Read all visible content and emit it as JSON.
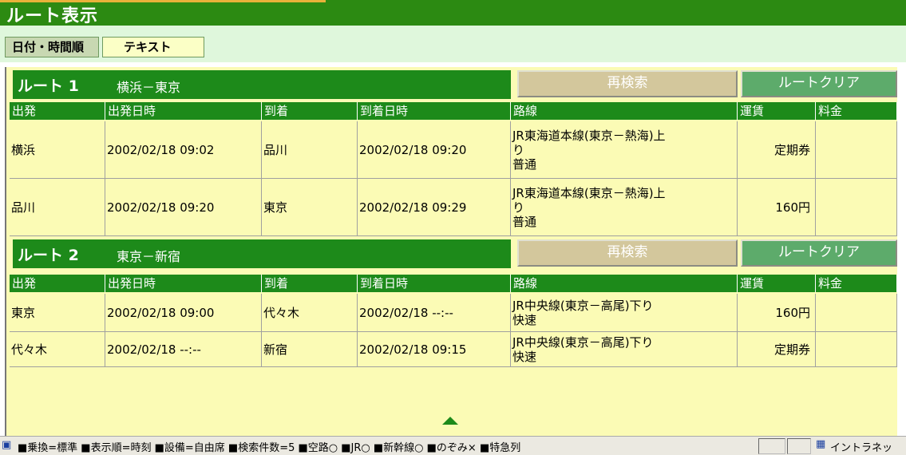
{
  "window": {
    "title": "ルート表示"
  },
  "tabs": [
    {
      "label": "日付・時間順"
    },
    {
      "label": "テキスト"
    }
  ],
  "columns": [
    "出発",
    "出発日時",
    "到着",
    "到着日時",
    "路線",
    "運賃",
    "料金"
  ],
  "buttons": {
    "research": "再検索",
    "clear": "ルートクリア"
  },
  "routes": [
    {
      "number": "ルート 1",
      "name": "横浜－東京",
      "rows": [
        {
          "depart": "横浜",
          "depart_time": "2002/02/18 09:02",
          "arrive": "品川",
          "arrive_time": "2002/02/18 09:20",
          "line1": "JR東海道本線(東京－熱海)上",
          "line2": "り",
          "line3": "普通",
          "fare": "定期券",
          "charge": ""
        },
        {
          "depart": "品川",
          "depart_time": "2002/02/18 09:20",
          "arrive": "東京",
          "arrive_time": "2002/02/18 09:29",
          "line1": "JR東海道本線(東京－熱海)上",
          "line2": "り",
          "line3": "普通",
          "fare": "160円",
          "charge": ""
        }
      ]
    },
    {
      "number": "ルート 2",
      "name": "東京－新宿",
      "rows": [
        {
          "depart": "東京",
          "depart_time": "2002/02/18 09:00",
          "arrive": "代々木",
          "arrive_time": "2002/02/18 --:--",
          "line1": "JR中央線(東京－高尾)下り",
          "line2": "快速",
          "fare": "160円",
          "charge": ""
        },
        {
          "depart": "代々木",
          "depart_time": "2002/02/18 --:--",
          "arrive": "新宿",
          "arrive_time": "2002/02/18 09:15",
          "line1": "JR中央線(東京－高尾)下り",
          "line2": "快速",
          "fare": "定期券",
          "charge": ""
        }
      ]
    }
  ],
  "status_bar": {
    "text": "■乗換=標準 ■表示順=時刻 ■設備=自由席 ■検索件数=5 ■空路○ ■JR○ ■新幹線○ ■のぞみ× ■特急列",
    "zone": "イントラネッ"
  },
  "colors": {
    "green": "#1d8a1a",
    "cell_bg": "#fbfbb5",
    "research_btn": "#d3c79c",
    "clear_btn": "#5dab6b"
  }
}
